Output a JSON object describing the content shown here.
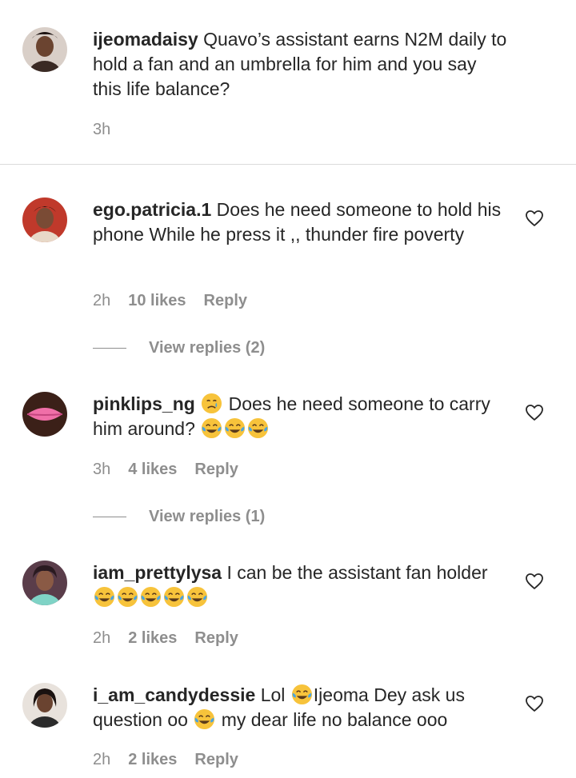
{
  "caption": {
    "username": "ijeomadaisy",
    "text": "Quavo’s assistant earns N2M daily to hold a fan and an umbrella for him and you say this life balance?",
    "time": "3h"
  },
  "comments": [
    {
      "username": "ego.patricia.1",
      "text": "Does he need someone to hold his phone While he press it ,, thunder fire poverty",
      "time": "2h",
      "likes": "10 likes",
      "reply_label": "Reply",
      "view_replies": "View replies (2)"
    },
    {
      "username": "pinklips_ng",
      "text_after_emoji": "Does he need someone to carry him around?",
      "time": "3h",
      "likes": "4 likes",
      "reply_label": "Reply",
      "view_replies": "View replies (1)"
    },
    {
      "username": "iam_prettylysa",
      "text": "I can be the assistant fan holder",
      "time": "2h",
      "likes": "2 likes",
      "reply_label": "Reply"
    },
    {
      "username": "i_am_candydessie",
      "text_1": "Lol",
      "text_2": "Ijeoma Dey ask us question oo",
      "text_3": "my dear life no balance ooo",
      "time": "2h",
      "likes": "2 likes",
      "reply_label": "Reply"
    }
  ],
  "icons": {
    "like": "heart-outline-icon",
    "laugh": "face-with-tears-of-joy-emoji",
    "cry": "crying-face-emoji"
  }
}
